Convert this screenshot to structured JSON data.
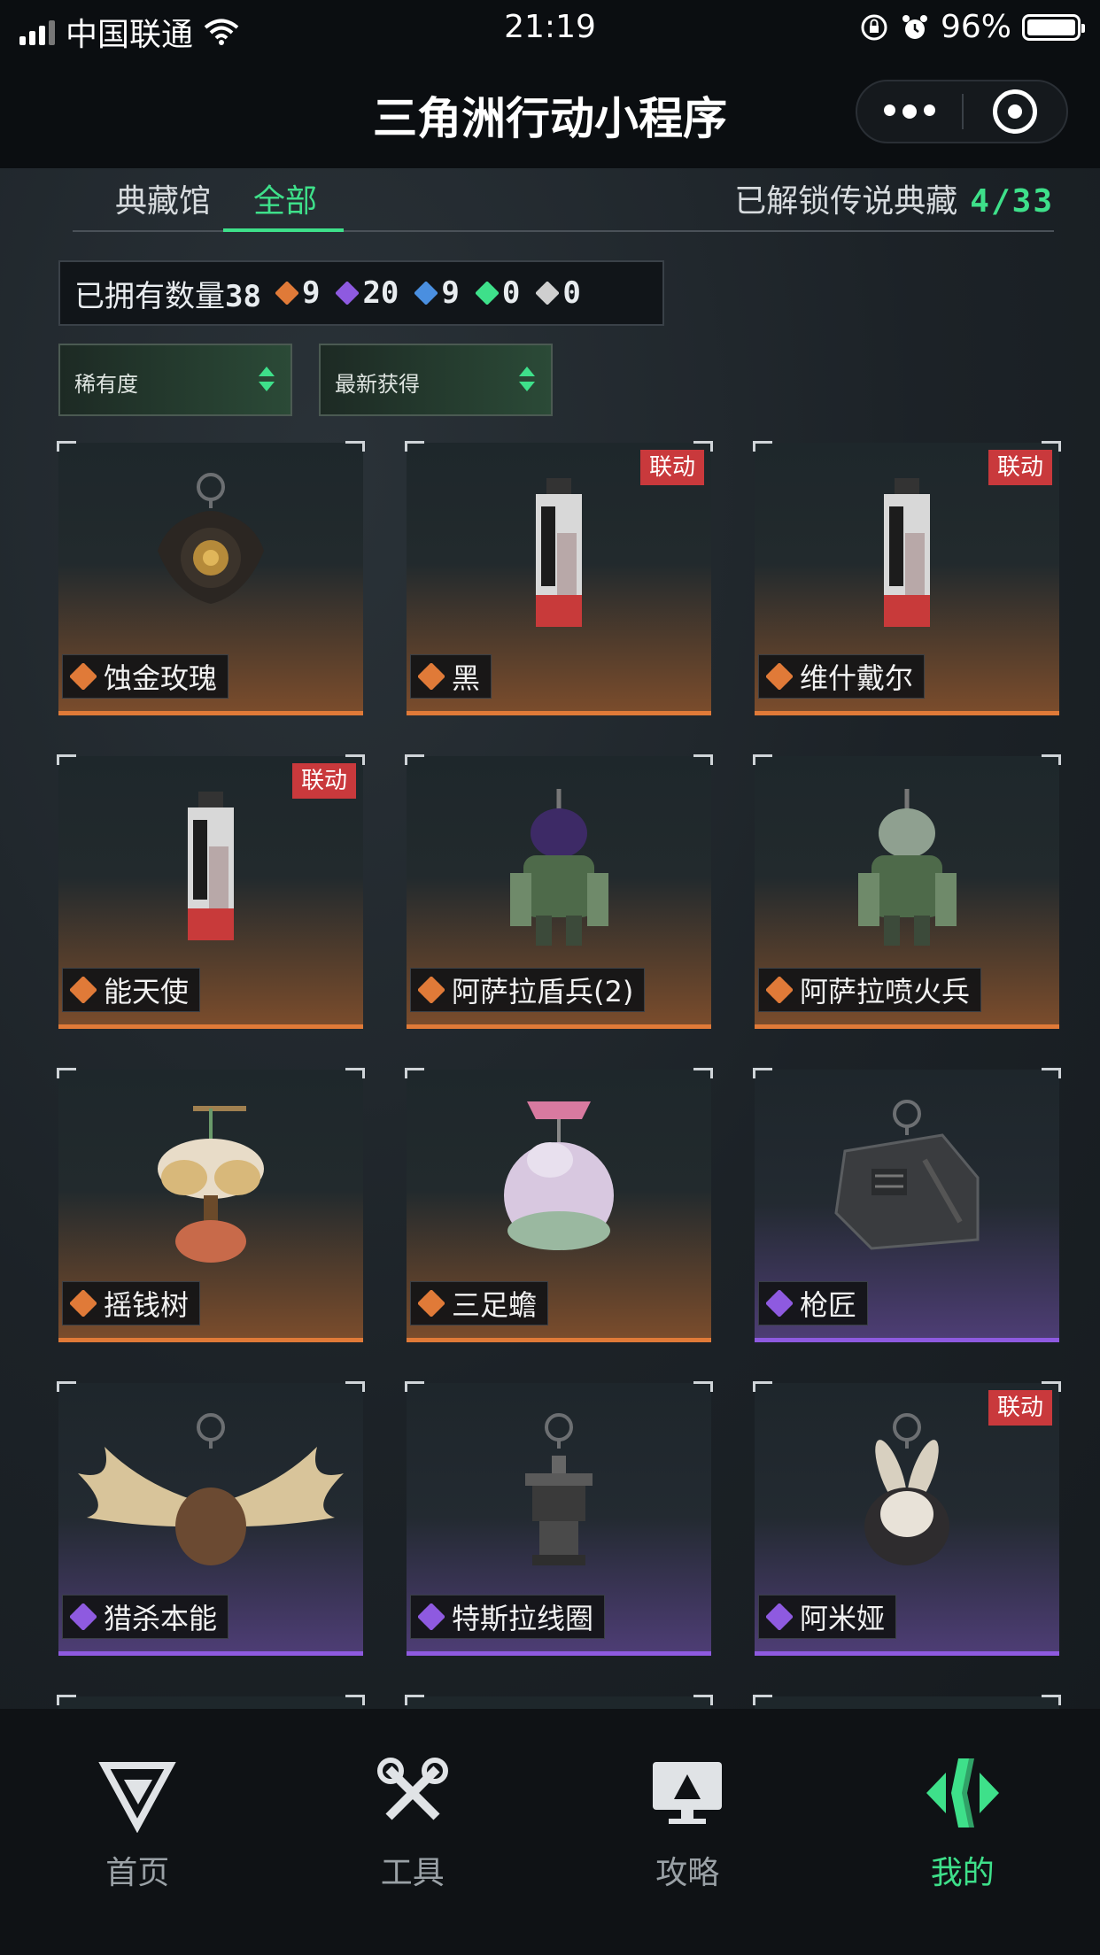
{
  "status_bar": {
    "carrier": "中国联通",
    "time": "21:19",
    "battery": "96%"
  },
  "title_bar": {
    "title": "三角洲行动小程序"
  },
  "tabs": {
    "items": [
      "典藏馆",
      "全部"
    ],
    "active_index": 1,
    "unlock_label": "已解锁传说典藏",
    "unlock_count": "4/33"
  },
  "owned": {
    "label": "已拥有数量",
    "total": "38",
    "rarity_counts": [
      {
        "rarity": "legendary",
        "color": "#e07a38",
        "count": "9"
      },
      {
        "rarity": "epic",
        "color": "#8e5ae0",
        "count": "20"
      },
      {
        "rarity": "rare",
        "color": "#4a8fe0",
        "count": "9"
      },
      {
        "rarity": "uncommon",
        "color": "#3ee08a",
        "count": "0"
      },
      {
        "rarity": "common",
        "color": "#cfcfcf",
        "count": "0"
      }
    ]
  },
  "filters": {
    "rarity": "稀有度",
    "sort": "最新获得"
  },
  "collab_tag": "联动",
  "items": [
    {
      "name": "蚀金玫瑰",
      "rarity": "legendary",
      "collab": false,
      "icon": "rose-pendant"
    },
    {
      "name": "黑",
      "rarity": "legendary",
      "collab": true,
      "icon": "card-pendant"
    },
    {
      "name": "维什戴尔",
      "rarity": "legendary",
      "collab": true,
      "icon": "card-pendant"
    },
    {
      "name": "能天使",
      "rarity": "legendary",
      "collab": true,
      "icon": "card-pendant"
    },
    {
      "name": "阿萨拉盾兵(2)",
      "rarity": "legendary",
      "collab": false,
      "icon": "figure-pendant"
    },
    {
      "name": "阿萨拉喷火兵",
      "rarity": "legendary",
      "collab": false,
      "icon": "figure-pendant"
    },
    {
      "name": "摇钱树",
      "rarity": "legendary",
      "collab": false,
      "icon": "tree-pendant"
    },
    {
      "name": "三足蟾",
      "rarity": "legendary",
      "collab": false,
      "icon": "toad-pendant"
    },
    {
      "name": "枪匠",
      "rarity": "epic",
      "collab": false,
      "icon": "case-pendant"
    },
    {
      "name": "猎杀本能",
      "rarity": "epic",
      "collab": false,
      "icon": "antler-pendant"
    },
    {
      "name": "特斯拉线圈",
      "rarity": "epic",
      "collab": false,
      "icon": "coil-pendant"
    },
    {
      "name": "阿米娅",
      "rarity": "epic",
      "collab": true,
      "icon": "bunny-pendant"
    }
  ],
  "bottom_nav": [
    {
      "label": "首页",
      "icon": "delta-logo-icon"
    },
    {
      "label": "工具",
      "icon": "tools-icon"
    },
    {
      "label": "攻略",
      "icon": "guide-monitor-icon"
    },
    {
      "label": "我的",
      "icon": "profile-logo-icon"
    }
  ],
  "bottom_nav_active": 3
}
